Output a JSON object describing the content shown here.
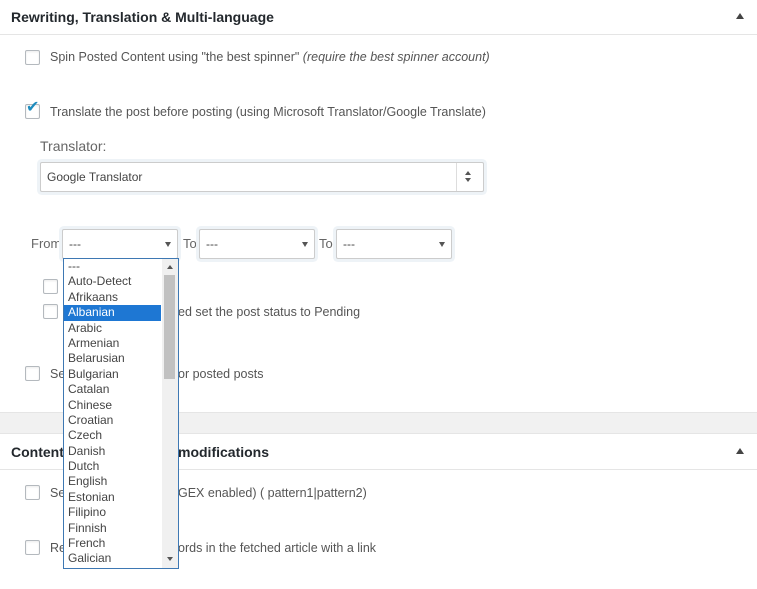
{
  "section1": {
    "title": "Rewriting, Translation & Multi-language",
    "spin_label": "Spin Posted Content using \"the best spinner\"",
    "spin_hint": "(require the best spinner account)",
    "translate_label": "Translate the post before posting (using Microsoft Translator/Google Translate)",
    "translator_heading": "Translator:",
    "translator_value": "Google Translator",
    "from_label": "From",
    "to_label_1": "To",
    "to_label_2": "To",
    "from_value": "---",
    "to1_value": "---",
    "to2_value": "---",
    "option_visible_text_1": "ed set the post status to Pending",
    "option_visible_text_2": "or posted posts",
    "option_visible_prefix_2": "Se"
  },
  "section2": {
    "title_left": "Content",
    "title_right": "modifications",
    "row1_prefix": "Se",
    "row1_text": "GEX enabled) ( pattern1|pattern2)",
    "row2_prefix": "Re",
    "row2_text": "ords in the fetched article with a link"
  },
  "dropdown": {
    "selected": "Albanian",
    "options": [
      "---",
      "Auto-Detect",
      "Afrikaans",
      "Albanian",
      "Arabic",
      "Armenian",
      "Belarusian",
      "Bulgarian",
      "Catalan",
      "Chinese",
      "Croatian",
      "Czech",
      "Danish",
      "Dutch",
      "English",
      "Estonian",
      "Filipino",
      "Finnish",
      "French",
      "Galician"
    ]
  }
}
